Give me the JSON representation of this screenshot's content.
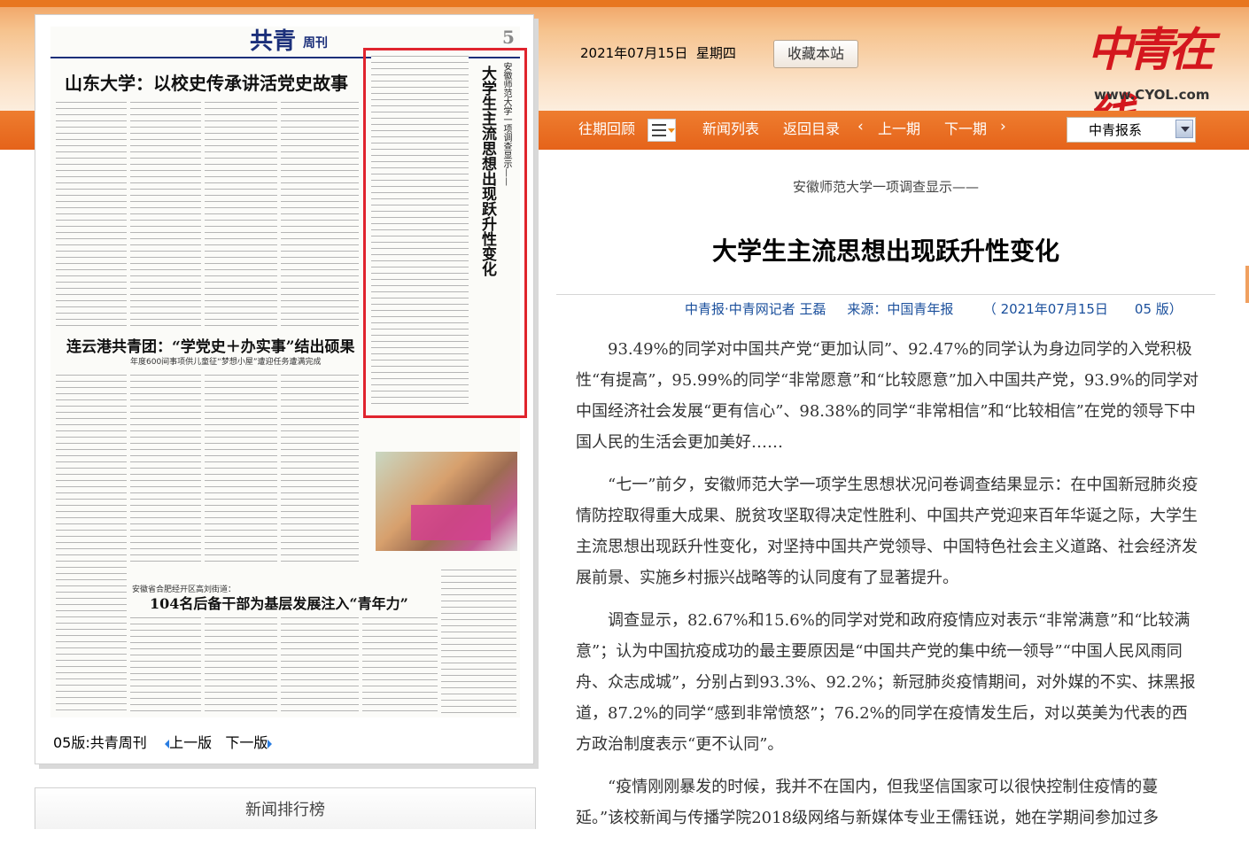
{
  "header": {
    "date": "2021年07月15日",
    "weekday": "星期四",
    "favorite_label": "收藏本站",
    "logo_text": "中青在线",
    "logo_url": "www.CYOL.com"
  },
  "nav": {
    "past": "往期回顾",
    "news_list": "新闻列表",
    "back_index": "返回目录",
    "prev_issue": "上一期",
    "next_issue": "下一期",
    "select_value": "中青报系"
  },
  "paper": {
    "masthead": "共青",
    "masthead_sub": "周刊",
    "page_no": "5",
    "headline1": "山东大学：以校史传承讲活党史故事",
    "headline2": "连云港共青团：“学党史＋办实事”结出硕果",
    "headline2_sub": "年度600间事项供儿童征“梦想小屋”遭迎任务遭满完成",
    "highlight_title": "大学生主流思想出现跃升性变化",
    "highlight_kicker": "安徽师范大学一项调查显示——",
    "headline3_kicker": "安徽省合肥经开区高刘街道：",
    "headline3": "104名后备干部为基层发展注入“青年力”",
    "footer_page": "05版:共青周刊",
    "footer_prev": "上一版",
    "footer_next": "下一版"
  },
  "ranking": {
    "title": "新闻排行榜"
  },
  "article": {
    "kicker": "安徽师范大学一项调查显示——",
    "title": "大学生主流思想出现跃升性变化",
    "author": "中青报·中青网记者 王磊",
    "source": "来源：中国青年报",
    "date_edition": "（ 2021年07月15日　　05 版）",
    "paragraphs": [
      "93.49%的同学对中国共产党“更加认同”、92.47%的同学认为身边同学的入党积极性“有提高”，95.99%的同学“非常愿意”和“比较愿意”加入中国共产党，93.9%的同学对中国经济社会发展“更有信心”、98.38%的同学“非常相信”和“比较相信”在党的领导下中国人民的生活会更加美好……",
      "“七一”前夕，安徽师范大学一项学生思想状况问卷调查结果显示：在中国新冠肺炎疫情防控取得重大成果、脱贫攻坚取得决定性胜利、中国共产党迎来百年华诞之际，大学生主流思想出现跃升性变化，对坚持中国共产党领导、中国特色社会主义道路、社会经济发展前景、实施乡村振兴战略等的认同度有了显著提升。",
      "调查显示，82.67%和15.6%的同学对党和政府疫情应对表示“非常满意”和“比较满意”；认为中国抗疫成功的最主要原因是“中国共产党的集中统一领导”“中国人民风雨同舟、众志成城”，分别占到93.3%、92.2%；新冠肺炎疫情期间，对外媒的不实、抹黑报道，87.2%的同学“感到非常愤怒”；76.2%的同学在疫情发生后，对以英美为代表的西方政治制度表示“更不认同”。",
      "“疫情刚刚暴发的时候，我并不在国内，但我坚信国家可以很快控制住疫情的蔓延。”该校新闻与传播学院2018级网络与新媒体专业王儒钰说，她在学期间参加过多"
    ]
  }
}
